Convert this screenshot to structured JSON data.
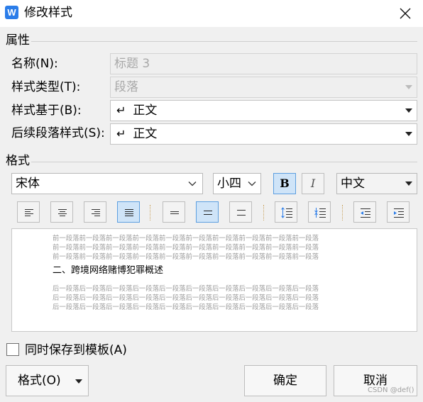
{
  "window": {
    "icon_letter": "W",
    "title": "修改样式"
  },
  "properties": {
    "heading": "属性",
    "name_label": "名称(N):",
    "name_value": "标题 3",
    "type_label": "样式类型(T):",
    "type_value": "段落",
    "based_on_label": "样式基于(B):",
    "based_on_value": "正文",
    "next_label": "后续段落样式(S):",
    "next_value": "正文"
  },
  "format": {
    "heading": "格式",
    "font": "宋体",
    "size": "小四",
    "bold_label": "B",
    "italic_label": "I",
    "script": "中文"
  },
  "preview": {
    "before_lines": [
      "前一段落前一段落前一段落前一段落前一段落前一段落前一段落前一段落前一段落前一段落",
      "前一段落前一段落前一段落前一段落前一段落前一段落前一段落前一段落前一段落前一段落",
      "前一段落前一段落前一段落前一段落前一段落前一段落前一段落前一段落前一段落前一段落"
    ],
    "main_text": "二、跨境网络赌博犯罪概述",
    "after_lines": [
      "后一段落后一段落后一段落后一段落后一段落后一段落后一段落后一段落后一段落后一段落",
      "后一段落后一段落后一段落后一段落后一段落后一段落后一段落后一段落后一段落后一段落",
      "后一段落后一段落后一段落后一段落后一段落后一段落后一段落后一段落后一段落后一段落"
    ]
  },
  "save_to_template": {
    "label": "同时保存到模板(A)",
    "checked": false
  },
  "buttons": {
    "format": "格式(O)",
    "ok": "确定",
    "cancel": "取消"
  },
  "watermark": "CSDN @def()",
  "colors": {
    "accent": "#2b7de9",
    "active_button_bg": "#cfe4f8",
    "active_button_border": "#5d9fe0"
  }
}
